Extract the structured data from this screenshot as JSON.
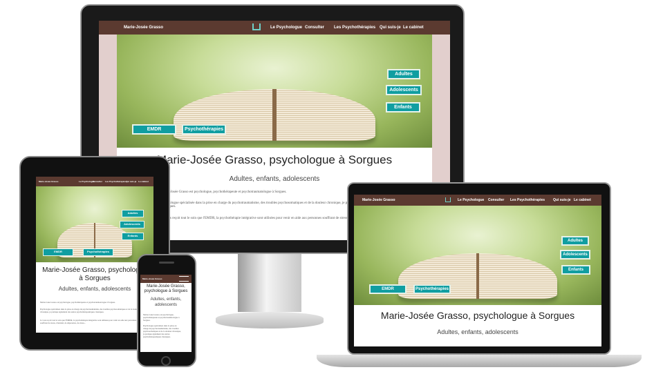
{
  "site": {
    "brand": "Marie-Josée Grasso",
    "nav": [
      "Le Psychologue",
      "Consulter",
      "Les Psychothérapies",
      "Qui suis-je",
      "Le cabinet"
    ],
    "buttons_right": [
      "Adultes",
      "Adolescents",
      "Enfants"
    ],
    "buttons_left": [
      "EMDR",
      "Psychothérapies"
    ],
    "title": "Marie-Josée Grasso, psychologue à Sorgues",
    "subtitle": "Adultes, enfants, adolescents",
    "para1": "Marie-Josée Grasso est psychologue, psychothérapeute et psychotraumatologue à Sorgues.",
    "para2": "Psychologue spécialisée dans la prise en charge du psychotraumatisme, des troubles psychosomatiques et de la douleur chronique, je pratique également des autres psychothérapeutiques classiques.",
    "para3": "Je vous reçoit tout le soin que l'EMDR, la psychothérapie intégrative sont utilisées pour venir en aide aux personnes souffrant de stress, d'anxiété, de dépression, de stress..."
  },
  "tablet": {
    "nav": [
      "Le Psychologue",
      "Consulter",
      "Les Psychothérapies",
      "Qui suis-je",
      "Le cabinet"
    ],
    "title_line1": "Marie-Josée Grasso, psychologue",
    "title_line2": "à Sorgues"
  },
  "phone": {
    "title_line1": "Marie-Josée Grasso,",
    "title_line2": "psychologue à Sorgues",
    "sub_line1": "Adultes, enfants,",
    "sub_line2": "adolescents"
  },
  "colors": {
    "nav": "#5b3a30",
    "teal": "#109ea1",
    "frame": "#111111"
  }
}
